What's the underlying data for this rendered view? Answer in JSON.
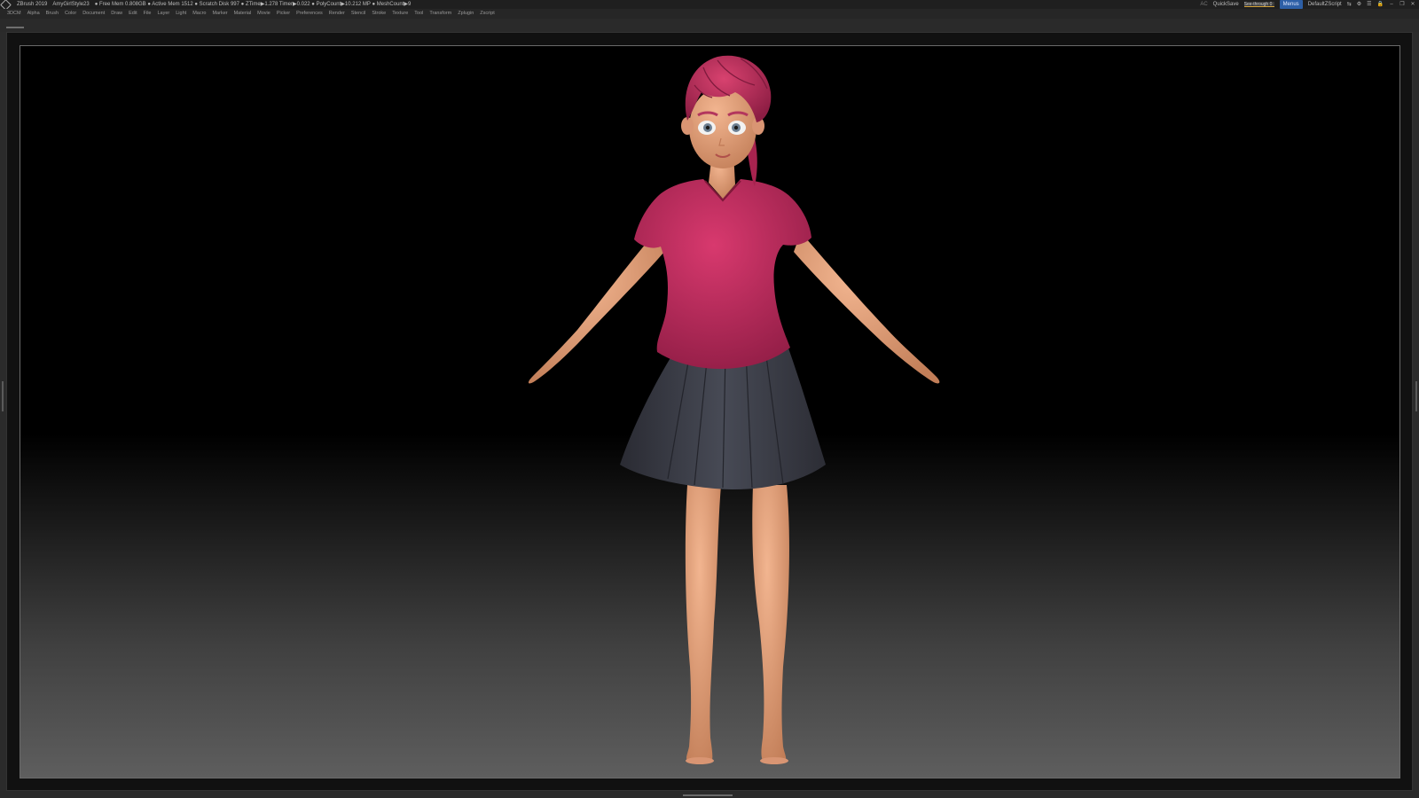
{
  "titlebar": {
    "app": "ZBrush 2019",
    "document": "AmyGirlStyle23",
    "stats": "● Free Mem 0.808GB ● Active Mem 1512 ● Scratch Disk 997 ● ZTime▶1.278 Timer▶0.022 ● PolyCount▶10.212 MP ● MeshCount▶9",
    "ac": "AC",
    "quicksave": "QuickSave",
    "see_through": "See-through 0",
    "menus_btn": "Menus",
    "script": "DefaultZScript"
  },
  "menubar": {
    "items": [
      "3DCM",
      "Alpha",
      "Brush",
      "Color",
      "Document",
      "Draw",
      "Edit",
      "File",
      "Layer",
      "Light",
      "Macro",
      "Marker",
      "Material",
      "Movie",
      "Picker",
      "Preferences",
      "Render",
      "Stencil",
      "Stroke",
      "Texture",
      "Tool",
      "Transform",
      "Zplugin",
      "Zscript"
    ]
  },
  "colors": {
    "shirt": "#c62e62",
    "hair": "#c2305e",
    "skin": "#e9a57c",
    "skirt": "#3a3c47"
  }
}
